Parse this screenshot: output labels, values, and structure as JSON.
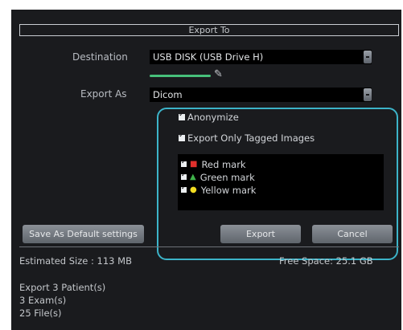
{
  "dialog": {
    "title": "Export To",
    "destination": {
      "label": "Destination",
      "value": "USB DISK (USB Drive H)"
    },
    "export_as": {
      "label": "Export As",
      "value": "Dicom"
    },
    "options": {
      "anonymize": "Anonymize",
      "export_tagged": "Export Only Tagged Images"
    },
    "marks": [
      {
        "label": "Red mark",
        "color": "#e0302c",
        "icon": "square"
      },
      {
        "label": "Green mark",
        "color": "#3fb34a",
        "icon": "triangle"
      },
      {
        "label": "Yellow mark",
        "color": "#f2dd22",
        "icon": "circle"
      }
    ],
    "buttons": {
      "save_default": "Save As Default settings",
      "export": "Export",
      "cancel": "Cancel"
    },
    "estimated_size": "Estimated Size : 113 MB",
    "free_space": "Free Space: 25.1 GB",
    "summary": {
      "patients": "Export 3 Patient(s)",
      "exams": "3 Exam(s)",
      "files": "25 File(s)"
    },
    "colors": {
      "highlight": "#3cb4c9",
      "progress": "#47c07a"
    }
  }
}
